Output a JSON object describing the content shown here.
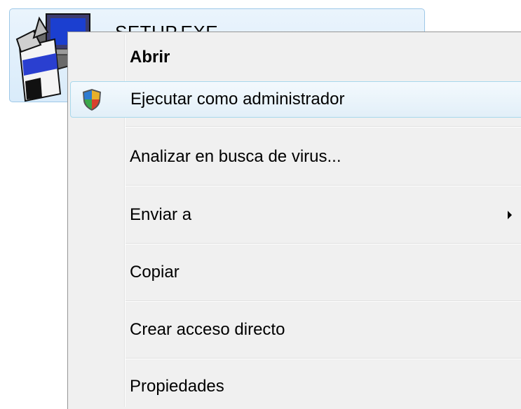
{
  "desktop": {
    "file_name": "SETUP.EXE",
    "file_icon": "installer-setup-icon"
  },
  "context_menu": {
    "items": [
      {
        "label": "Abrir",
        "bold": true
      },
      {
        "label": "Ejecutar como administrador",
        "icon": "uac-shield-icon",
        "highlighted": true
      },
      {
        "label": "Analizar en busca de virus..."
      },
      {
        "label": "Enviar a",
        "has_submenu": true
      },
      {
        "label": "Copiar"
      },
      {
        "label": "Crear acceso directo"
      },
      {
        "label": "Propiedades"
      }
    ]
  },
  "colors": {
    "menu_background": "#f0f0f0",
    "menu_border": "#979797",
    "highlight_border": "#a8d8eb",
    "selection_border": "#9ec8e8"
  }
}
